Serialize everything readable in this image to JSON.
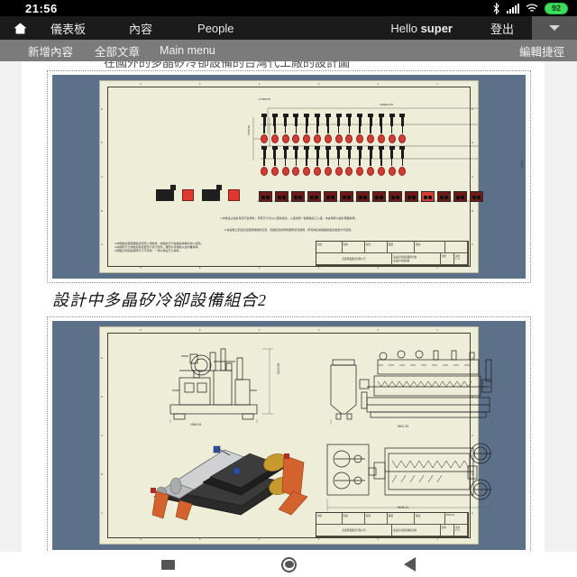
{
  "status_bar": {
    "clock": "21:56",
    "battery_level": "92",
    "icons": [
      "bluetooth-icon",
      "cellular-signal-icon",
      "wifi-icon",
      "battery-icon"
    ],
    "battery_color": "#3ddc5a",
    "background": "#000000"
  },
  "admin_bar": {
    "home_icon": "home-icon",
    "items": [
      {
        "label": "儀表板"
      },
      {
        "label": "內容"
      },
      {
        "label": "People"
      }
    ],
    "greeting_prefix": "Hello ",
    "greeting_user": "super",
    "logout_label": "登出",
    "caret_icon": "chevron-down-icon",
    "background": "#1b1b1b"
  },
  "toolbar": {
    "items": [
      {
        "label": "新增內容"
      },
      {
        "label": "全部文章"
      },
      {
        "label": "Main menu"
      }
    ],
    "edit_shortcut_label": "編輯捷徑",
    "background": "#7b7b7b"
  },
  "page": {
    "cut_off_heading": "在國外的多晶矽冷卻設備的台灣代工廠的設計圖",
    "figures": [
      {
        "name": "polysilicon-cooling-assembly-drawing-1",
        "sheet_background": "#eeedd8",
        "mount_color": "#5c7189",
        "title_block": {
          "row1": [
            "項次",
            "名稱",
            "材質",
            "數量",
            "備註",
            ""
          ],
          "row2_left": "奕盛興業股份有限公司",
          "row2_right_top": "多晶矽冷卻設備組合圖",
          "row2_right_bottom": "多晶矽冷卻設備",
          "scale_label": "比例",
          "sheet_label": "張次",
          "sheet_value": "1 / 2"
        },
        "dimensions": {
          "top_left": "A=508.35",
          "top_main": "10698.5.05",
          "left_1": "1058.68",
          "left_2": "478.47",
          "right_1": "1160.5"
        },
        "ruler_top": [
          "6",
          "5",
          "4",
          "3",
          "2",
          "1"
        ],
        "ruler_bottom": [
          "6",
          "5",
          "4",
          "3",
          "2",
          "1"
        ],
        "ruler_left": [
          "E",
          "D",
          "C",
          "B",
          "A"
        ],
        "ruler_right": [
          "E",
          "D",
          "C",
          "B",
          "A"
        ],
        "nozzle_count_per_row": 14,
        "nozzle_rows": 2,
        "unit_box_count": 14,
        "note_line_1": "1.本產品之設計除另行註明外，所有尺寸皆以公厘為單位，公差依照一般機械加工公差，未註明者以設計圖面為準。",
        "note_line_2": "2.本設備之安裝位置需預留維修空間，管路配置依現場實際狀況調整，所有焊接處需經檢驗合格後方可使用。",
        "note_block": "※本圖為奕盛興業股份有限公司財產，非經許可不得複製或轉交他人使用。\n※本圖所示之規格如有變更恕不另行通知，實際交貨規格以合約書為準。\n※圖面比例如與實際尺寸不符時，一律以標註尺寸為準。"
      },
      {
        "name": "polysilicon-cooling-assembly-drawing-2",
        "sheet_background": "#eeedd8",
        "mount_color": "#5c7189",
        "title_block": {
          "row1": [
            "項次",
            "名稱",
            "材質",
            "數量",
            "備註",
            "5064.14"
          ],
          "row2_left": "奕盛興業股份有限公司",
          "row2_right": "多晶矽冷卻設備組合圖",
          "scale_label": "比例",
          "sheet_label": "張次",
          "sheet_value": "2 / 2"
        },
        "dimensions": {
          "front_height": "3013.35",
          "front_width": "1584.94",
          "side_width": "5611.33",
          "plan_width": "5645.14"
        },
        "ruler_top": [
          "6",
          "5",
          "4",
          "3",
          "2",
          "1"
        ],
        "ruler_bottom": [
          "6",
          "5",
          "4",
          "3",
          "2",
          "1"
        ],
        "ruler_left": [
          "E",
          "D",
          "C",
          "B",
          "A"
        ],
        "ruler_right": [
          "E",
          "D",
          "C",
          "B",
          "A"
        ],
        "views": [
          "front-elevation-view",
          "side-elevation-view",
          "isometric-3d-view",
          "plan-view"
        ]
      }
    ],
    "caption": "設計中多晶矽冷卻設備組合2"
  },
  "nav_bar": {
    "recents_icon": "recents-square-icon",
    "home_icon": "home-circle-icon",
    "back_icon": "back-triangle-icon"
  }
}
